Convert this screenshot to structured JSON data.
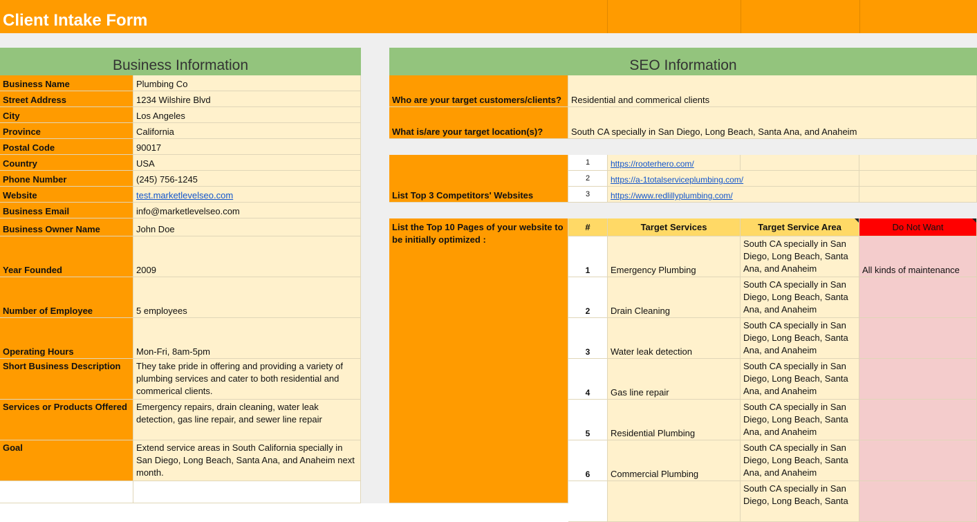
{
  "title": "Client Intake Form",
  "business": {
    "header": "Business Information",
    "rows": [
      {
        "label": "Business Name",
        "value": "Plumbing Co"
      },
      {
        "label": "Street Address",
        "value": "1234 Wilshire Blvd"
      },
      {
        "label": "City",
        "value": "Los Angeles"
      },
      {
        "label": "Province",
        "value": "California"
      },
      {
        "label": "Postal Code",
        "value": "90017"
      },
      {
        "label": "Country",
        "value": "USA"
      },
      {
        "label": "Phone Number",
        "value": "(245) 756-1245"
      },
      {
        "label": "Website",
        "value": "test.marketlevelseo.com"
      },
      {
        "label": "Business Email",
        "value": "info@marketlevelseo.com"
      },
      {
        "label": "Business Owner Name",
        "value": "John Doe"
      },
      {
        "label": "Year Founded",
        "value": "2009"
      },
      {
        "label": "Number of Employee",
        "value": "5 employees"
      },
      {
        "label": "Operating Hours",
        "value": "Mon-Fri, 8am-5pm"
      },
      {
        "label": "Short Business Description",
        "value": "They take pride in offering and providing a variety of plumbing services and cater to both residential and commerical clients."
      },
      {
        "label": "Services or Products Offered",
        "value": "Emergency repairs, drain cleaning, water leak detection, gas line repair, and sewer line repair"
      },
      {
        "label": "Goal",
        "value": "Extend service areas in South California specially in San Diego, Long Beach, Santa Ana, and Anaheim next month."
      }
    ]
  },
  "seo": {
    "header": "SEO Information",
    "target_customers_label": "Who are your target customers/clients?",
    "target_customers_value": "Residential and commerical clients",
    "target_location_label": "What is/are your target location(s)?",
    "target_location_value": "South CA specially in San Diego, Long Beach, Santa Ana, and Anaheim",
    "competitors_label": "List Top 3 Competitors' Websites",
    "competitors": [
      {
        "num": "1",
        "url": "https://rooterhero.com/"
      },
      {
        "num": "2",
        "url": "https://a-1totalserviceplumbing.com/"
      },
      {
        "num": "3",
        "url": "https://www.redlillyplumbing.com/"
      }
    ],
    "pages_label": "List the Top 10 Pages of your website to be initially optimized :",
    "pages_headers": {
      "num": "#",
      "services": "Target Services",
      "area": "Target Service Area",
      "donot": "Do Not Want"
    },
    "pages": [
      {
        "num": "1",
        "service": "Emergency Plumbing",
        "area": "South CA specially in San Diego, Long Beach, Santa Ana, and Anaheim",
        "donot": "All kinds of maintenance"
      },
      {
        "num": "2",
        "service": "Drain Cleaning",
        "area": "South CA specially in San Diego, Long Beach, Santa Ana, and Anaheim",
        "donot": ""
      },
      {
        "num": "3",
        "service": "Water leak detection",
        "area": "South CA specially in San Diego, Long Beach, Santa Ana, and Anaheim",
        "donot": ""
      },
      {
        "num": "4",
        "service": "Gas line repair",
        "area": "South CA specially in San Diego, Long Beach, Santa Ana, and Anaheim",
        "donot": ""
      },
      {
        "num": "5",
        "service": "Residential Plumbing",
        "area": "South CA specially in San Diego, Long Beach, Santa Ana, and Anaheim",
        "donot": ""
      },
      {
        "num": "6",
        "service": "Commercial Plumbing",
        "area": "South CA specially in San Diego, Long Beach, Santa Ana, and Anaheim",
        "donot": ""
      },
      {
        "num": "",
        "service": "",
        "area": "South CA specially in San Diego, Long Beach, Santa",
        "donot": ""
      }
    ]
  },
  "colors": {
    "orange": "#ff9b00",
    "cream": "#fff1cc",
    "green": "#93c47d",
    "pink": "#f4cccc",
    "yellow_header": "#ffd966",
    "red": "#ff0000"
  }
}
